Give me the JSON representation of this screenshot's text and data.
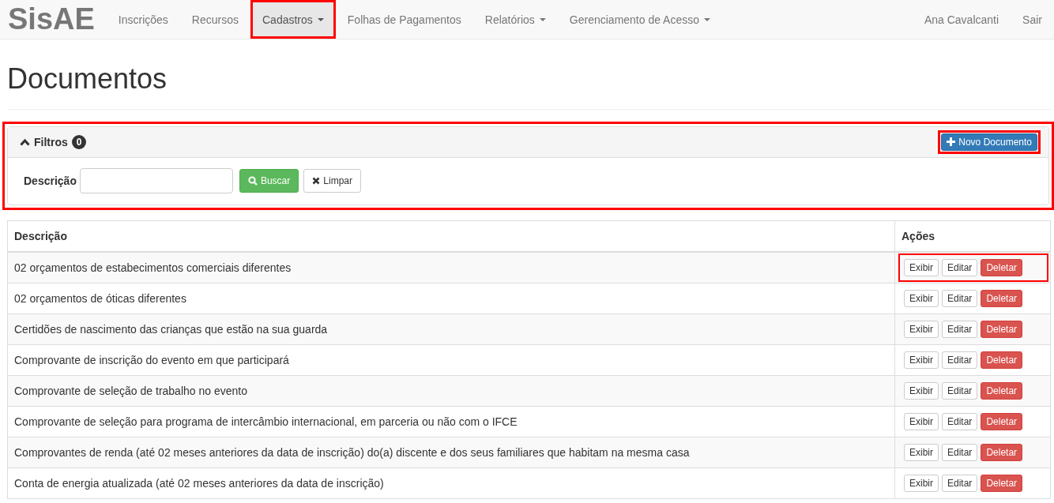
{
  "navbar": {
    "brand": "SisAE",
    "items": [
      {
        "label": "Inscrições",
        "dropdown": false,
        "selected": false,
        "highlighted": false
      },
      {
        "label": "Recursos",
        "dropdown": false,
        "selected": false,
        "highlighted": false
      },
      {
        "label": "Cadastros",
        "dropdown": true,
        "selected": true,
        "highlighted": true
      },
      {
        "label": "Folhas de Pagamentos",
        "dropdown": false,
        "selected": false,
        "highlighted": false
      },
      {
        "label": "Relatórios",
        "dropdown": true,
        "selected": false,
        "highlighted": false
      },
      {
        "label": "Gerenciamento de Acesso",
        "dropdown": true,
        "selected": false,
        "highlighted": false
      }
    ],
    "right_items": [
      "Ana Cavalcanti",
      "Sair"
    ]
  },
  "page_title": "Documentos",
  "filters": {
    "title": "Filtros",
    "count": "0",
    "expanded": true,
    "highlighted": true,
    "new_button": {
      "label": "Novo Documento",
      "highlighted": true
    },
    "field_label": "Descrição",
    "search_button": "Buscar",
    "clear_button": "Limpar"
  },
  "table": {
    "columns": [
      "Descrição",
      "Ações"
    ],
    "rows": [
      {
        "description": "02 orçamentos de estabecimentos comerciais diferentes",
        "actions": [
          "Exibir",
          "Editar",
          "Deletar"
        ],
        "highlighted": true
      },
      {
        "description": "02 orçamentos de óticas diferentes",
        "actions": [
          "Exibir",
          "Editar",
          "Deletar"
        ],
        "highlighted": false
      },
      {
        "description": "Certidões de nascimento das crianças que estão na sua guarda",
        "actions": [
          "Exibir",
          "Editar",
          "Deletar"
        ],
        "highlighted": false
      },
      {
        "description": "Comprovante de inscrição do evento em que participará",
        "actions": [
          "Exibir",
          "Editar",
          "Deletar"
        ],
        "highlighted": false
      },
      {
        "description": "Comprovante de seleção de trabalho no evento",
        "actions": [
          "Exibir",
          "Editar",
          "Deletar"
        ],
        "highlighted": false
      },
      {
        "description": "Comprovante de seleção para programa de intercâmbio internacional, em parceria ou não com o IFCE",
        "actions": [
          "Exibir",
          "Editar",
          "Deletar"
        ],
        "highlighted": false
      },
      {
        "description": "Comprovantes de renda (até 02 meses anteriores da data de inscrição) do(a) discente e dos seus familiares que habitam na mesma casa",
        "actions": [
          "Exibir",
          "Editar",
          "Deletar"
        ],
        "highlighted": false
      },
      {
        "description": "Conta de energia atualizada (até 02 meses anteriores da data de inscrição)",
        "actions": [
          "Exibir",
          "Editar",
          "Deletar"
        ],
        "highlighted": false
      }
    ]
  }
}
